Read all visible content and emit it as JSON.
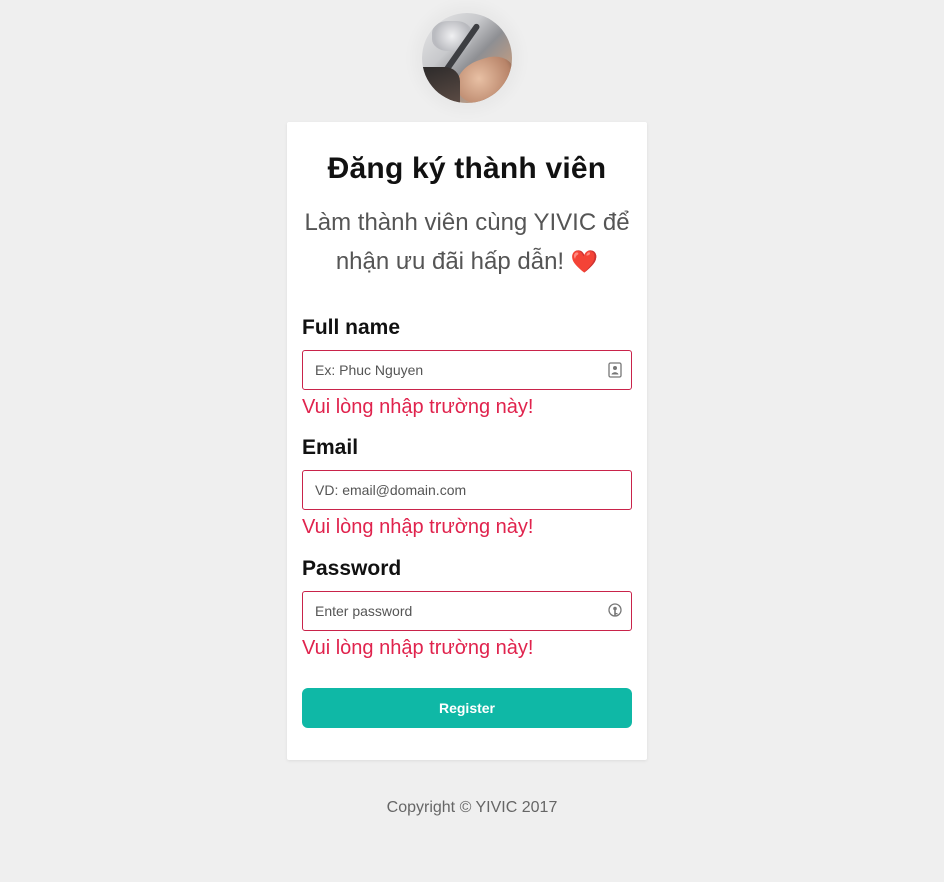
{
  "header": {
    "title": "Đăng ký thành viên",
    "subtitle": "Làm thành viên cùng YIVIC để nhận ưu đãi hấp dẫn!",
    "subtitle_emoji": "❤️"
  },
  "form": {
    "fullname": {
      "label": "Full name",
      "placeholder": "Ex: Phuc Nguyen",
      "value": "",
      "error": "Vui lòng nhập trường này!",
      "icon": "contact-card-icon"
    },
    "email": {
      "label": "Email",
      "placeholder": "VD: email@domain.com",
      "value": "",
      "error": "Vui lòng nhập trường này!"
    },
    "password": {
      "label": "Password",
      "placeholder": "Enter password",
      "value": "",
      "error": "Vui lòng nhập trường này!",
      "icon": "key-icon"
    },
    "submit_label": "Register"
  },
  "footer": {
    "copyright": "Copyright © YIVIC 2017"
  },
  "colors": {
    "accent": "#0fb8a6",
    "error": "#e0234d",
    "input_border_error": "#c9234a",
    "background": "#efefef"
  }
}
